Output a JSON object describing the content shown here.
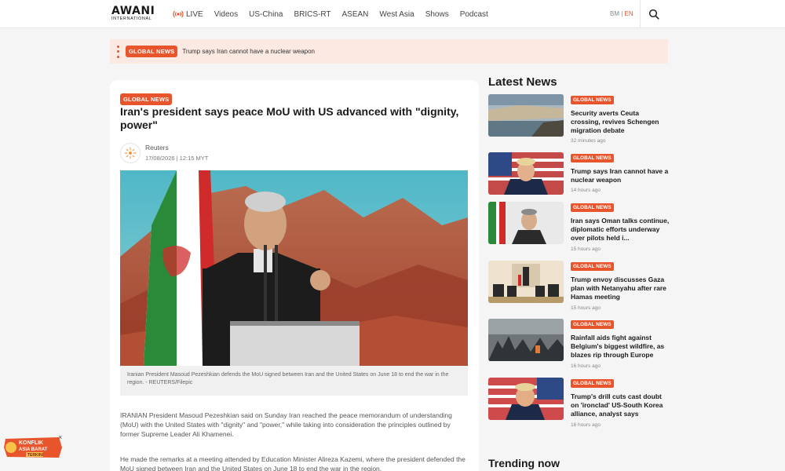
{
  "header": {
    "logo_brand": "AWANI",
    "logo_sub": "INTERNATIONAL",
    "nav": [
      "LIVE",
      "Videos",
      "US-China",
      "BRICS-RT",
      "ASEAN",
      "West Asia",
      "Shows",
      "Podcast"
    ],
    "lang_bm": "BM",
    "lang_sep": "|",
    "lang_en": "EN"
  },
  "breaking": {
    "badge": "GLOBAL NEWS",
    "text": "Trump says Iran cannot have a nuclear weapon"
  },
  "article": {
    "category": "GLOBAL NEWS",
    "title": "Iran's president says peace MoU with US advanced with \"dignity, power\"",
    "author": "Reuters",
    "date": "17/08/2026 | 12:15 MYT",
    "caption": "Iranian President Masoud Pezeshkian defends the MoU signed between Iran and the United States on June 18 to end the war in the region. - REUTERS/Filepic",
    "paragraph1": "IRANIAN President Masoud Pezeshkian said on Sunday Iran reached the peace memorandum of understanding (MoU) with the United States with \"dignity\" and \"power,\" while taking into consideration the principles outlined by former Supreme Leader Ali Khamenei.",
    "paragraph2": "He made the remarks at a meeting attended by Education Minister Alireza Kazemi, where the president defended the MoU signed between Iran and the United States on June 18 to end the war in the region."
  },
  "latest": {
    "heading": "Latest News",
    "items": [
      {
        "badge": "GLOBAL NEWS",
        "title": "Security averts Ceuta crossing, revives Schengen migration debate",
        "time": "32 minutes ago"
      },
      {
        "badge": "GLOBAL NEWS",
        "title": "Trump says Iran cannot have a nuclear weapon",
        "time": "14 hours ago"
      },
      {
        "badge": "GLOBAL NEWS",
        "title": "Iran says Oman talks continue, diplomatic efforts underway over pilots held i...",
        "time": "15 hours ago"
      },
      {
        "badge": "GLOBAL NEWS",
        "title": "Trump envoy discusses Gaza plan with Netanyahu after rare Hamas meeting",
        "time": "15 hours ago"
      },
      {
        "badge": "GLOBAL NEWS",
        "title": "Rainfall aids fight against Belgium's biggest wildfire, as blazes rip through Europe",
        "time": "16 hours ago"
      },
      {
        "badge": "GLOBAL NEWS",
        "title": "Trump's drill cuts cast doubt on 'ironclad' US-South Korea alliance, analyst says",
        "time": "16 hours ago"
      }
    ]
  },
  "trending": {
    "heading": "Trending now"
  },
  "floating": {
    "line1": "KONFLIK",
    "line2": "ASIA BARAT",
    "line3": "TERKINI",
    "close": "×"
  }
}
